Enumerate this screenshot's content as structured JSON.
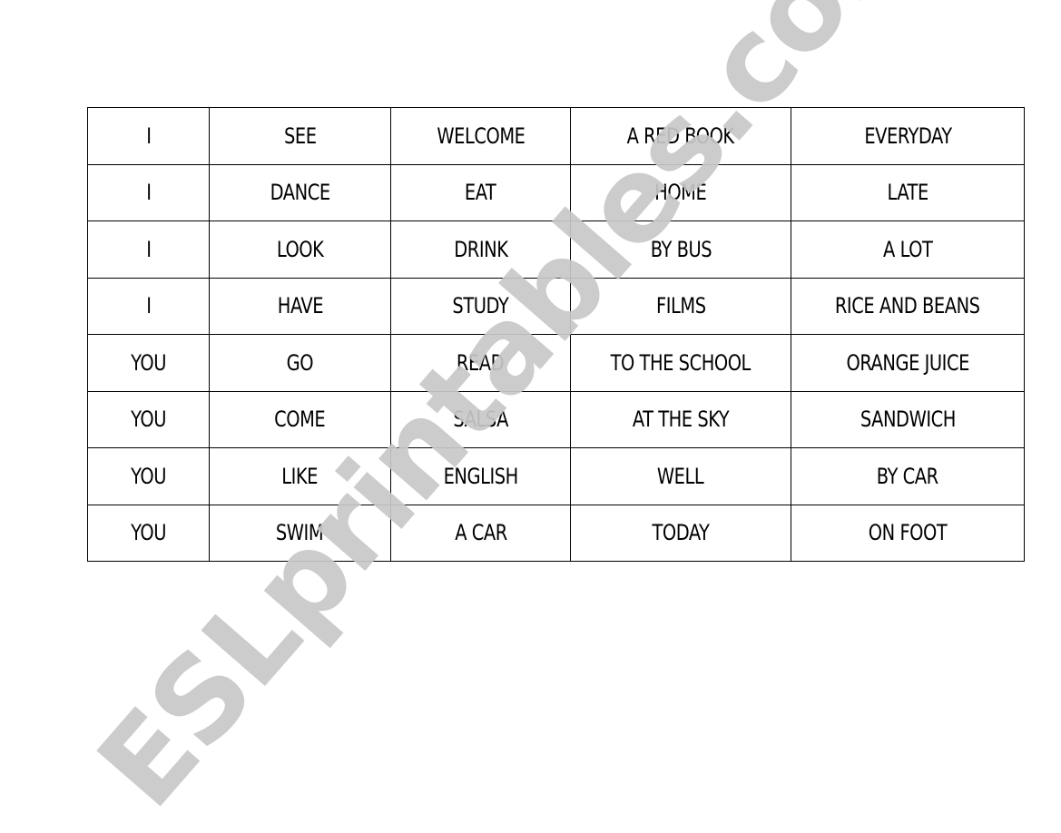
{
  "table": {
    "rows": [
      [
        "I",
        "SEE",
        "WELCOME",
        "A RED BOOK",
        "EVERYDAY"
      ],
      [
        "I",
        "DANCE",
        "EAT",
        "HOME",
        "LATE"
      ],
      [
        "I",
        "LOOK",
        "DRINK",
        "BY BUS",
        "A LOT"
      ],
      [
        "I",
        "HAVE",
        "STUDY",
        "FILMS",
        "RICE AND BEANS"
      ],
      [
        "YOU",
        "GO",
        "READ",
        "TO THE SCHOOL",
        "ORANGE JUICE"
      ],
      [
        "YOU",
        "COME",
        "SALSA",
        "AT THE SKY",
        "SANDWICH"
      ],
      [
        "YOU",
        "LIKE",
        "ENGLISH",
        "WELL",
        "BY CAR"
      ],
      [
        "YOU",
        "SWIM",
        "A CAR",
        "TODAY",
        "ON FOOT"
      ]
    ]
  },
  "watermark": {
    "text": "ESLprintables.com",
    "color": "#c8c8c8"
  }
}
